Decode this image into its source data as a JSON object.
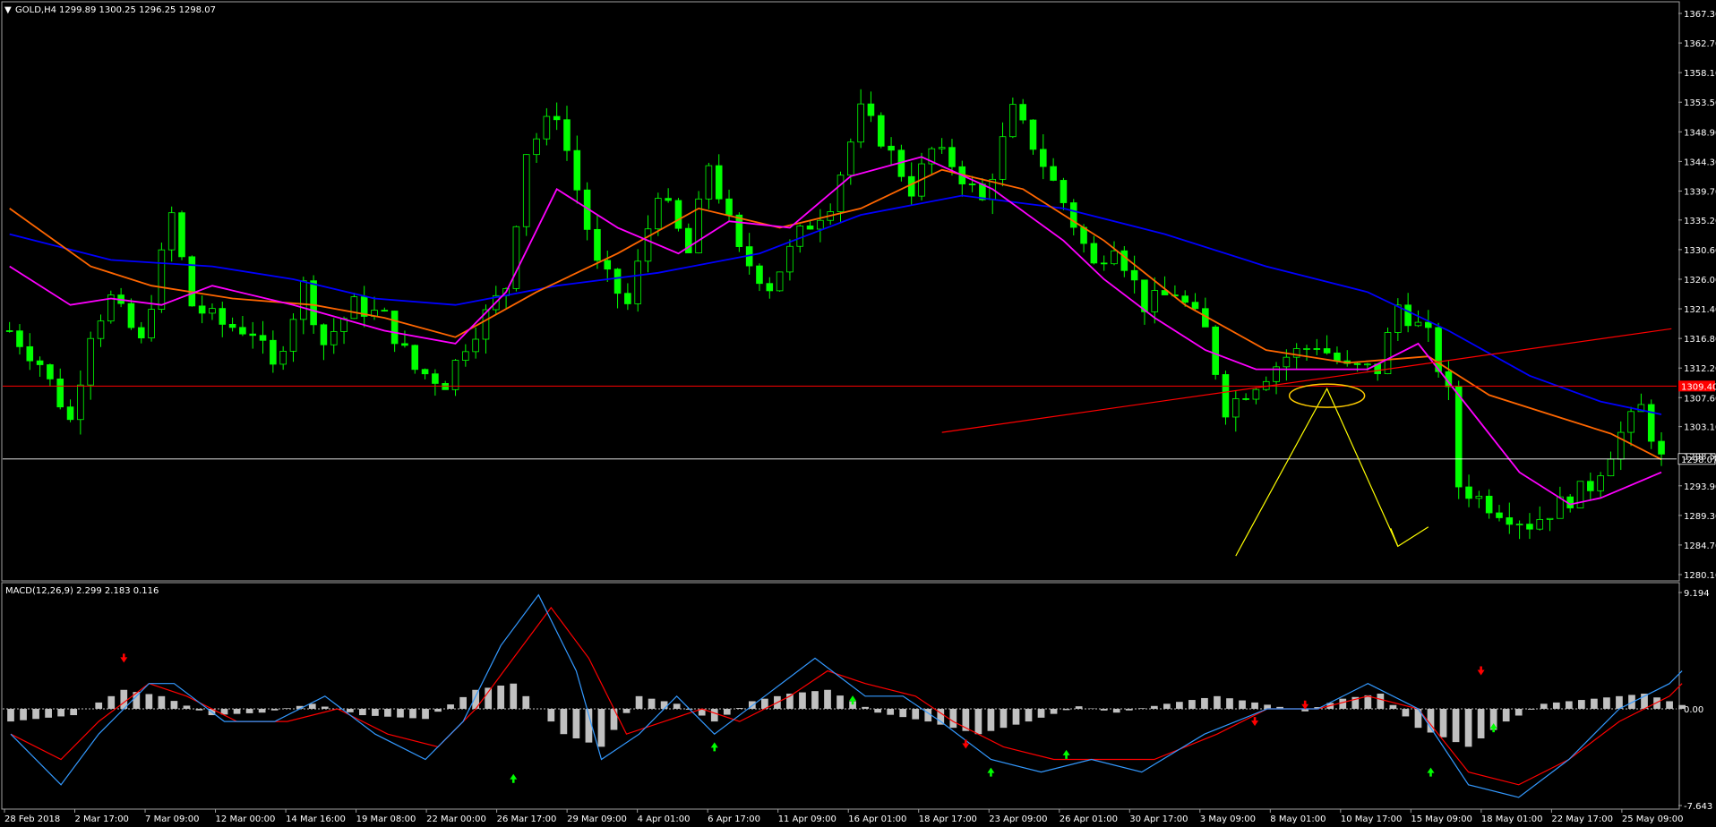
{
  "header": {
    "symbol_label": "GOLD,H4",
    "ohlc": "1299.89 1300.25 1296.25 1298.07",
    "dropdown_glyph": "▼"
  },
  "macd_header": {
    "label": "MACD(12,26,9) 2.299 2.183 0.116"
  },
  "colors": {
    "background": "#000000",
    "candle": "#00ff00",
    "ma_fast": "#ff00ff",
    "ma_mid": "#ff6600",
    "ma_slow": "#0000ff",
    "resistance": "#ff0000",
    "trend": "#ff0000",
    "projection": "#ffff00",
    "price_line": "#ffffff",
    "histogram": "#c0c0c0",
    "macd_line": "#3399ff",
    "signal_line": "#ff0000",
    "arrow_up": "#00ff00",
    "arrow_down": "#ff0000"
  },
  "chart_data": [
    {
      "type": "candlestick",
      "symbol": "GOLD",
      "timeframe": "H4",
      "ylim": [
        1280.1,
        1367.3
      ],
      "price_ticks": [
        "1367.30",
        "1362.70",
        "1358.10",
        "1353.50",
        "1348.90",
        "1344.30",
        "1339.70",
        "1335.20",
        "1330.60",
        "1326.00",
        "1321.40",
        "1316.80",
        "1312.20",
        "1307.60",
        "1303.10",
        "1298.50",
        "1293.90",
        "1289.30",
        "1284.70",
        "1280.10"
      ],
      "current_price_label": "1298.07",
      "current_price": 1298.07,
      "resistance_label": "1309.40",
      "resistance_price": 1309.4,
      "x_ticks": [
        "28 Feb 2018",
        "2 Mar 17:00",
        "7 Mar 09:00",
        "12 Mar 00:00",
        "14 Mar 16:00",
        "19 Mar 08:00",
        "22 Mar 00:00",
        "26 Mar 17:00",
        "29 Mar 09:00",
        "4 Apr 01:00",
        "6 Apr 17:00",
        "11 Apr 09:00",
        "16 Apr 01:00",
        "18 Apr 17:00",
        "23 Apr 09:00",
        "26 Apr 01:00",
        "30 Apr 17:00",
        "3 May 09:00",
        "8 May 01:00",
        "10 May 17:00",
        "15 May 09:00",
        "18 May 01:00",
        "22 May 17:00",
        "25 May 09:00"
      ],
      "close_path": [
        [
          0,
          1318
        ],
        [
          3,
          1313
        ],
        [
          6,
          1304
        ],
        [
          8,
          1318
        ],
        [
          10,
          1323
        ],
        [
          13,
          1316
        ],
        [
          16,
          1336
        ],
        [
          18,
          1322
        ],
        [
          21,
          1319
        ],
        [
          24,
          1318
        ],
        [
          26,
          1312
        ],
        [
          29,
          1325
        ],
        [
          31,
          1316
        ],
        [
          34,
          1322
        ],
        [
          37,
          1320
        ],
        [
          40,
          1312
        ],
        [
          43,
          1310
        ],
        [
          45,
          1316
        ],
        [
          49,
          1325
        ],
        [
          51,
          1346
        ],
        [
          54,
          1352
        ],
        [
          56,
          1340
        ],
        [
          58,
          1328
        ],
        [
          61,
          1322
        ],
        [
          64,
          1340
        ],
        [
          67,
          1330
        ],
        [
          69,
          1344
        ],
        [
          72,
          1330
        ],
        [
          75,
          1325
        ],
        [
          78,
          1333
        ],
        [
          81,
          1338
        ],
        [
          84,
          1352
        ],
        [
          86,
          1348
        ],
        [
          89,
          1340
        ],
        [
          91,
          1346
        ],
        [
          93,
          1344
        ],
        [
          96,
          1338
        ],
        [
          99,
          1352
        ],
        [
          101,
          1347
        ],
        [
          104,
          1338
        ],
        [
          107,
          1328
        ],
        [
          109,
          1332
        ],
        [
          112,
          1322
        ],
        [
          115,
          1324
        ],
        [
          118,
          1318
        ],
        [
          120,
          1306
        ],
        [
          123,
          1310
        ],
        [
          126,
          1314
        ],
        [
          129,
          1316
        ],
        [
          132,
          1312
        ],
        [
          135,
          1312
        ],
        [
          137,
          1322
        ],
        [
          140,
          1317
        ],
        [
          142,
          1308
        ],
        [
          143,
          1294
        ],
        [
          146,
          1291
        ],
        [
          150,
          1288
        ],
        [
          153,
          1291
        ],
        [
          156,
          1294
        ],
        [
          159,
          1302
        ],
        [
          161,
          1306
        ],
        [
          163,
          1298
        ]
      ],
      "ma_fast": [
        [
          0,
          1328
        ],
        [
          6,
          1322
        ],
        [
          10,
          1323
        ],
        [
          15,
          1322
        ],
        [
          20,
          1325
        ],
        [
          28,
          1322
        ],
        [
          37,
          1318
        ],
        [
          44,
          1316
        ],
        [
          49,
          1324
        ],
        [
          54,
          1340
        ],
        [
          60,
          1334
        ],
        [
          66,
          1330
        ],
        [
          71,
          1335
        ],
        [
          77,
          1334
        ],
        [
          83,
          1342
        ],
        [
          90,
          1345
        ],
        [
          97,
          1340
        ],
        [
          104,
          1332
        ],
        [
          108,
          1326
        ],
        [
          113,
          1320
        ],
        [
          118,
          1315
        ],
        [
          123,
          1312
        ],
        [
          128,
          1312
        ],
        [
          134,
          1312
        ],
        [
          139,
          1316
        ],
        [
          143,
          1308
        ],
        [
          149,
          1296
        ],
        [
          154,
          1291
        ],
        [
          157,
          1292
        ],
        [
          160,
          1294
        ],
        [
          163,
          1296
        ]
      ],
      "ma_mid": [
        [
          0,
          1337
        ],
        [
          8,
          1328
        ],
        [
          14,
          1325
        ],
        [
          22,
          1323
        ],
        [
          30,
          1322
        ],
        [
          37,
          1320
        ],
        [
          44,
          1317
        ],
        [
          52,
          1324
        ],
        [
          60,
          1330
        ],
        [
          68,
          1337
        ],
        [
          76,
          1334
        ],
        [
          84,
          1337
        ],
        [
          92,
          1343
        ],
        [
          100,
          1340
        ],
        [
          108,
          1332
        ],
        [
          116,
          1322
        ],
        [
          124,
          1315
        ],
        [
          132,
          1313
        ],
        [
          140,
          1314
        ],
        [
          146,
          1308
        ],
        [
          152,
          1305
        ],
        [
          158,
          1302
        ],
        [
          163,
          1298
        ]
      ],
      "ma_slow": [
        [
          0,
          1333
        ],
        [
          10,
          1329
        ],
        [
          20,
          1328
        ],
        [
          28,
          1326
        ],
        [
          36,
          1323
        ],
        [
          44,
          1322
        ],
        [
          54,
          1325
        ],
        [
          64,
          1327
        ],
        [
          74,
          1330
        ],
        [
          84,
          1336
        ],
        [
          94,
          1339
        ],
        [
          104,
          1337
        ],
        [
          114,
          1333
        ],
        [
          124,
          1328
        ],
        [
          134,
          1324
        ],
        [
          142,
          1318
        ],
        [
          150,
          1311
        ],
        [
          157,
          1307
        ],
        [
          163,
          1305
        ]
      ],
      "trendline": [
        [
          92,
          1302.2
        ],
        [
          164,
          1318.3
        ]
      ],
      "projection": [
        [
          121,
          1283
        ],
        [
          130,
          1309
        ],
        [
          137,
          1284.5
        ],
        [
          140,
          1287.5
        ]
      ],
      "ellipse": {
        "x": 130,
        "y": 1307.9
      }
    },
    {
      "type": "macd",
      "params": "MACD(12,26,9)",
      "values": {
        "macd": 2.299,
        "signal": 2.183,
        "histogram": 0.116
      },
      "ylim": [
        -7.643,
        9.194
      ],
      "tick_labels": [
        "9.194",
        "0.00",
        "-7.643"
      ],
      "macd_line": [
        [
          0,
          -2
        ],
        [
          4,
          -6
        ],
        [
          7,
          -2
        ],
        [
          11,
          2
        ],
        [
          13,
          2
        ],
        [
          17,
          -1
        ],
        [
          21,
          -1
        ],
        [
          25,
          1
        ],
        [
          29,
          -2
        ],
        [
          33,
          -4
        ],
        [
          36,
          -1
        ],
        [
          39,
          5
        ],
        [
          42,
          9
        ],
        [
          45,
          3
        ],
        [
          47,
          -4
        ],
        [
          50,
          -2
        ],
        [
          53,
          1
        ],
        [
          56,
          -2
        ],
        [
          60,
          1
        ],
        [
          64,
          4
        ],
        [
          68,
          1
        ],
        [
          71,
          1
        ],
        [
          74,
          -1
        ],
        [
          78,
          -4
        ],
        [
          82,
          -5
        ],
        [
          86,
          -4
        ],
        [
          90,
          -5
        ],
        [
          95,
          -2
        ],
        [
          100,
          0
        ],
        [
          104,
          0
        ],
        [
          108,
          2
        ],
        [
          112,
          0
        ],
        [
          116,
          -6
        ],
        [
          120,
          -7
        ],
        [
          124,
          -4
        ],
        [
          128,
          0
        ],
        [
          132,
          2
        ],
        [
          133,
          3
        ]
      ],
      "signal_line": [
        [
          0,
          -2
        ],
        [
          4,
          -4
        ],
        [
          7,
          -1
        ],
        [
          11,
          2
        ],
        [
          14,
          1
        ],
        [
          18,
          -1
        ],
        [
          22,
          -1
        ],
        [
          26,
          0
        ],
        [
          30,
          -2
        ],
        [
          34,
          -3
        ],
        [
          37,
          0
        ],
        [
          40,
          4
        ],
        [
          43,
          8
        ],
        [
          46,
          4
        ],
        [
          49,
          -2
        ],
        [
          52,
          -1
        ],
        [
          55,
          0
        ],
        [
          58,
          -1
        ],
        [
          62,
          1
        ],
        [
          65,
          3
        ],
        [
          68,
          2
        ],
        [
          72,
          1
        ],
        [
          75,
          -1
        ],
        [
          79,
          -3
        ],
        [
          83,
          -4
        ],
        [
          87,
          -4
        ],
        [
          91,
          -4
        ],
        [
          96,
          -2
        ],
        [
          100,
          0
        ],
        [
          104,
          0
        ],
        [
          108,
          1
        ],
        [
          112,
          0
        ],
        [
          116,
          -5
        ],
        [
          120,
          -6
        ],
        [
          124,
          -4
        ],
        [
          128,
          -1
        ],
        [
          132,
          1
        ],
        [
          133,
          2
        ]
      ],
      "histogram": [
        [
          0,
          -1
        ],
        [
          5,
          -0.5
        ],
        [
          9,
          1.5
        ],
        [
          12,
          1
        ],
        [
          16,
          -0.5
        ],
        [
          20,
          -0.3
        ],
        [
          24,
          0.4
        ],
        [
          28,
          -0.5
        ],
        [
          33,
          -0.8
        ],
        [
          37,
          1.5
        ],
        [
          40,
          2
        ],
        [
          44,
          -2
        ],
        [
          47,
          -3
        ],
        [
          50,
          1
        ],
        [
          53,
          0.4
        ],
        [
          56,
          -1
        ],
        [
          59,
          0.6
        ],
        [
          62,
          1.2
        ],
        [
          65,
          1.5
        ],
        [
          69,
          -0.3
        ],
        [
          73,
          -1
        ],
        [
          77,
          -2
        ],
        [
          81,
          -1
        ],
        [
          85,
          0.2
        ],
        [
          88,
          -0.3
        ],
        [
          92,
          0.4
        ],
        [
          96,
          1
        ],
        [
          99,
          0.5
        ],
        [
          103,
          -0.2
        ],
        [
          106,
          0.8
        ],
        [
          109,
          1.2
        ],
        [
          112,
          -1.5
        ],
        [
          116,
          -3
        ],
        [
          119,
          -1
        ],
        [
          122,
          0.4
        ],
        [
          126,
          0.8
        ],
        [
          130,
          1.2
        ],
        [
          133,
          0.3
        ]
      ],
      "arrows_up": [
        [
          40,
          -5.5
        ],
        [
          56,
          -3
        ],
        [
          67,
          0.7
        ],
        [
          78,
          -5
        ],
        [
          84,
          -3.6
        ],
        [
          113,
          -5
        ],
        [
          118,
          -1.5
        ]
      ],
      "arrows_down": [
        [
          9,
          4
        ],
        [
          76,
          -2.8
        ],
        [
          99,
          -1
        ],
        [
          103,
          0.3
        ],
        [
          117,
          3
        ]
      ]
    }
  ]
}
